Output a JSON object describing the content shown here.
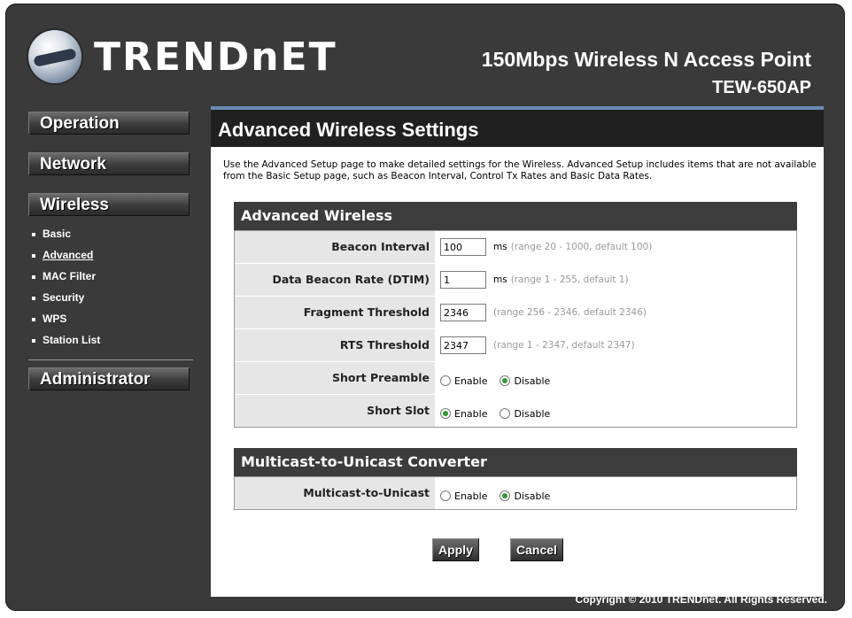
{
  "header": {
    "logo_text": "TRENDnET",
    "product_title": "150Mbps Wireless N Access Point",
    "model": "TEW-650AP"
  },
  "sidebar": {
    "items": [
      {
        "label": "Operation"
      },
      {
        "label": "Network"
      },
      {
        "label": "Wireless"
      },
      {
        "label": "Administrator"
      }
    ],
    "wireless_sub": [
      {
        "label": "Basic"
      },
      {
        "label": "Advanced",
        "active": true
      },
      {
        "label": "MAC Filter"
      },
      {
        "label": "Security"
      },
      {
        "label": "WPS"
      },
      {
        "label": "Station List"
      }
    ]
  },
  "main": {
    "title": "Advanced Wireless Settings",
    "description": "Use the Advanced Setup page to make detailed settings for the Wireless. Advanced Setup includes items that are not available from the Basic Setup page, such as Beacon Interval, Control Tx Rates and Basic Data Rates.",
    "advanced_section": {
      "heading": "Advanced Wireless",
      "beacon_interval": {
        "label": "Beacon Interval",
        "value": "100",
        "unit": "ms",
        "hint": "(range 20 - 1000, default 100)"
      },
      "dtim": {
        "label": "Data Beacon Rate (DTIM)",
        "value": "1",
        "unit": "ms",
        "hint": "(range 1 - 255, default 1)"
      },
      "fragment": {
        "label": "Fragment Threshold",
        "value": "2346",
        "hint": "(range 256 - 2346, default 2346)"
      },
      "rts": {
        "label": "RTS Threshold",
        "value": "2347",
        "hint": "(range 1 - 2347, default 2347)"
      },
      "short_preamble": {
        "label": "Short Preamble",
        "enable": "Enable",
        "disable": "Disable",
        "selected": "Disable"
      },
      "short_slot": {
        "label": "Short Slot",
        "enable": "Enable",
        "disable": "Disable",
        "selected": "Enable"
      }
    },
    "multicast_section": {
      "heading": "Multicast-to-Unicast Converter",
      "multicast": {
        "label": "Multicast-to-Unicast",
        "enable": "Enable",
        "disable": "Disable",
        "selected": "Disable"
      }
    },
    "buttons": {
      "apply": "Apply",
      "cancel": "Cancel"
    }
  },
  "footer": {
    "copyright": "Copyright © 2010 TRENDnet. All Rights Reserved."
  },
  "colors": {
    "accent_bar": "#6a8bb3",
    "radio_selected": "#2f9a2f",
    "frame": "#3a3a3a"
  }
}
